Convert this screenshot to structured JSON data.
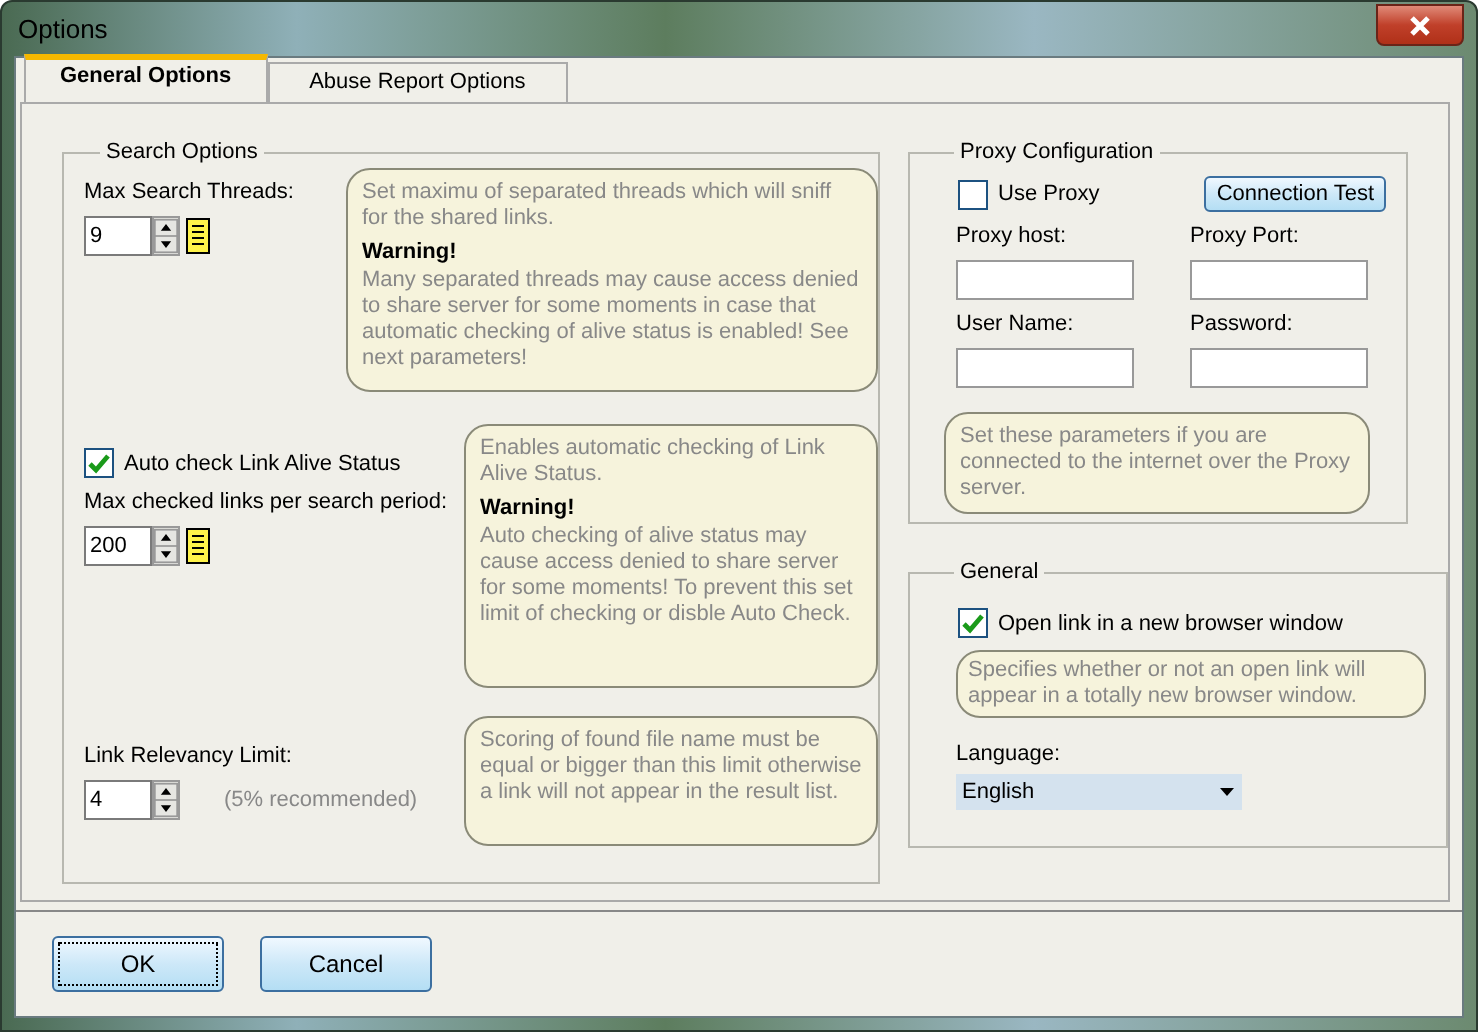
{
  "window": {
    "title": "Options"
  },
  "tabs": [
    {
      "label": "General Options",
      "selected": true
    },
    {
      "label": "Abuse Report Options",
      "selected": false
    }
  ],
  "search_options": {
    "title": "Search Options",
    "rows": [
      {
        "label": "Max Search Threads:",
        "value": "9",
        "list_button": true,
        "note": {
          "text": "Set maximu of separated threads which will sniff for the shared links.",
          "warning_title": "Warning!",
          "warning_text": "Many separated threads may cause access denied to share server for some moments in case that automatic checking of alive status is enabled! See next parameters!"
        }
      },
      {
        "checkbox": {
          "label": "Auto check Link Alive Status",
          "checked": true
        },
        "label": "Max checked links per search period:",
        "value": "200",
        "list_button": true,
        "note": {
          "text": "Enables automatic checking of Link Alive Status.",
          "warning_title": "Warning!",
          "warning_text": "Auto checking of alive status may cause access denied to share server for some moments! To prevent this set limit of checking or disble Auto Check."
        }
      },
      {
        "label": "Link Relevancy Limit:",
        "value": "4",
        "list_button": false,
        "hint": "(5% recommended)",
        "note": {
          "text": "Scoring of found file name must be equal or bigger than this limit otherwise a link will not appear in the result list."
        }
      }
    ]
  },
  "proxy": {
    "title": "Proxy Configuration",
    "use_proxy": {
      "label": "Use Proxy",
      "checked": false
    },
    "test_button": "Connection Test",
    "fields": [
      {
        "label": "Proxy host:"
      },
      {
        "label": "Proxy Port:"
      },
      {
        "label": "User Name:"
      },
      {
        "label": "Password:"
      }
    ],
    "note": "Set these parameters if you are connected to the internet over the Proxy server."
  },
  "general": {
    "title": "General",
    "open_new_window": {
      "label": "Open link in a new browser window",
      "checked": true
    },
    "note": "Specifies whether or not an open link will appear in a totally new browser window.",
    "language": {
      "label": "Language:",
      "value": "English"
    }
  },
  "buttons": [
    {
      "label": "OK",
      "focused": true
    },
    {
      "label": "Cancel",
      "focused": false
    }
  ]
}
